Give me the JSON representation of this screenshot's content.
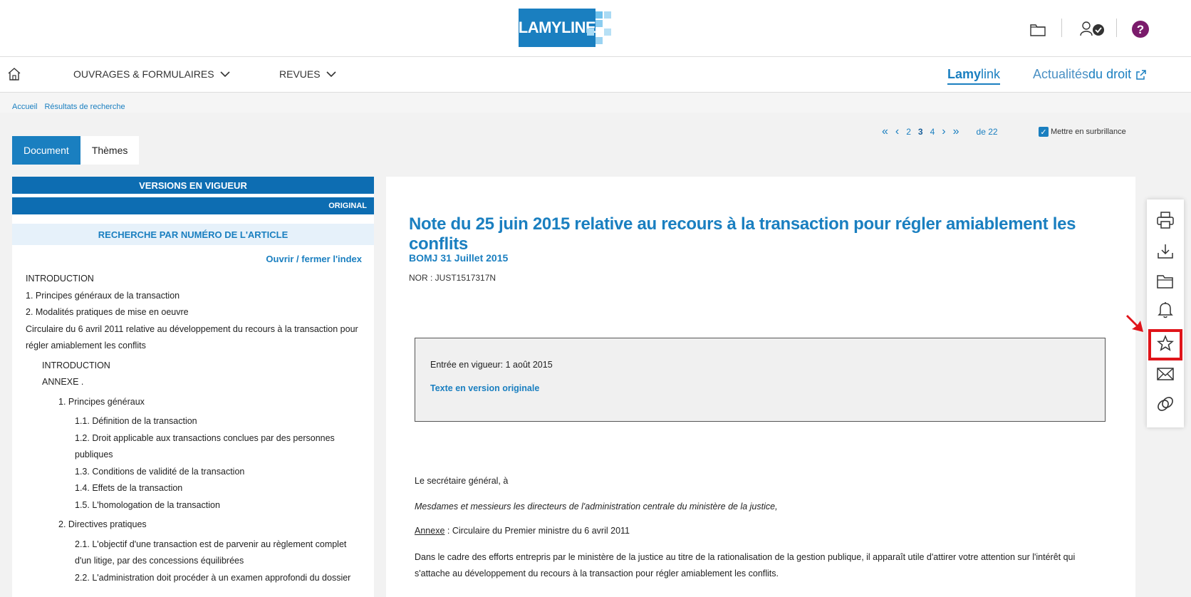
{
  "header": {
    "logo_text": "LAMYLINE",
    "icons": [
      "folder-icon",
      "user-verified-icon",
      "help-icon"
    ]
  },
  "nav": {
    "home_icon": "home-icon",
    "items": [
      {
        "label": "OUVRAGES & FORMULAIRES"
      },
      {
        "label": "REVUES"
      }
    ],
    "lamylink_a": "Lamy",
    "lamylink_b": "link",
    "actualites_a": "Actualités",
    "actualites_b": " du droit"
  },
  "breadcrumb": [
    "Accueil",
    "Résultats de recherche"
  ],
  "tabs": {
    "document": "Document",
    "themes": "Thèmes"
  },
  "pager": {
    "pages": [
      "2",
      "3",
      "4"
    ],
    "current": "3",
    "total_label": "de 22"
  },
  "highlight": {
    "label": "Mettre en surbrillance",
    "checked": true
  },
  "sidebar": {
    "versions_label": "VERSIONS EN VIGUEUR",
    "original_label": "ORIGINAL",
    "search_label": "RECHERCHE PAR NUMÉRO DE L'ARTICLE",
    "toggle_index": "Ouvrir / fermer l'index",
    "toc": [
      {
        "level": 0,
        "text": "INTRODUCTION"
      },
      {
        "level": 0,
        "text": "1. Principes généraux de la transaction"
      },
      {
        "level": 0,
        "text": "2. Modalités pratiques de mise en oeuvre"
      },
      {
        "level": 0,
        "text": "Circulaire du 6 avril 2011 relative au développement du recours à la transaction pour régler amiablement les conflits"
      },
      {
        "level": 1,
        "text": "INTRODUCTION"
      },
      {
        "level": 1,
        "text": "ANNEXE ."
      },
      {
        "level": 2,
        "text": "1. Principes généraux"
      },
      {
        "level": 3,
        "text": "1.1. Définition de la transaction"
      },
      {
        "level": 3,
        "text": "1.2. Droit applicable aux transactions conclues par des personnes publiques"
      },
      {
        "level": 3,
        "text": "1.3. Conditions de validité de la transaction"
      },
      {
        "level": 3,
        "text": "1.4. Effets de la transaction"
      },
      {
        "level": 3,
        "text": "1.5. L'homologation de la transaction"
      },
      {
        "level": 2,
        "text": "2. Directives pratiques"
      },
      {
        "level": 3,
        "text": "2.1. L'objectif d'une transaction est de parvenir au règlement complet d'un litige, par des concessions équilibrées"
      },
      {
        "level": 3,
        "text": "2.2. L'administration doit procéder à un examen approfondi du dossier"
      }
    ]
  },
  "document": {
    "title": "Note du 25 juin 2015 relative au recours à la transaction pour régler amiablement les conflits",
    "source": "BOMJ 31 Juillet 2015",
    "nor": "NOR : JUST1517317N",
    "entry_label": "Entrée en vigueur: 1 août 2015",
    "original_link": "Texte en version originale",
    "p1": "Le secrétaire général, à",
    "p2": "Mesdames et messieurs les directeurs de l'administration centrale du ministère de la justice,",
    "annexe_label": "Annexe",
    "annexe_text": " : Circulaire du Premier ministre du 6 avril 2011",
    "p4a": "Dans le cadre des efforts entrepris par le ministère de la justice au titre de la rationalisation de la gestion publique, il apparaît utile d'attirer votre attention sur l'intérêt qui",
    "p4b": "s'attache au développement du recours à la transaction pour régler amiablement les conflits."
  },
  "toolbar": {
    "buttons": [
      "print-icon",
      "download-icon",
      "folder-icon",
      "bell-icon",
      "star-icon",
      "mail-icon",
      "link-icon"
    ]
  },
  "colors": {
    "brand": "#1a7fc0",
    "sidebar_bar": "#0d6db2",
    "highlight_red": "#e0141a",
    "help_purple": "#7a1b6b"
  }
}
